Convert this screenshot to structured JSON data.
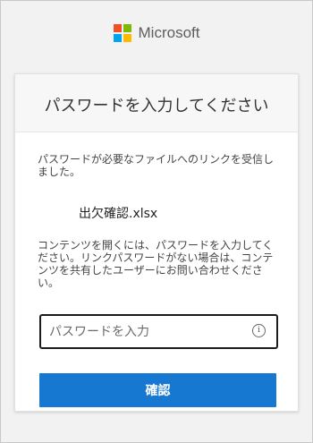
{
  "brand": {
    "name": "Microsoft",
    "logo_colors": [
      "#f25022",
      "#7fba00",
      "#00a4ef",
      "#ffb900"
    ]
  },
  "card": {
    "title": "パスワードを入力してください",
    "message": "パスワードが必要なファイルへのリンクを受信しました。",
    "filename": "出欠確認.xlsx",
    "info": "コンテンツを開くには、パスワードを入力してください。リンクパスワードがない場合は、コンテンツを共有したユーザーにお問い合わせください。",
    "password": {
      "placeholder": "パスワードを入力",
      "value": "",
      "info_icon_glyph": "i"
    },
    "confirm_label": "確認"
  },
  "colors": {
    "accent": "#1778d2",
    "background": "#f2f2f2",
    "card": "#ffffff"
  },
  "icons": {
    "logo": "microsoft-logo-icon",
    "info": "info-icon"
  }
}
